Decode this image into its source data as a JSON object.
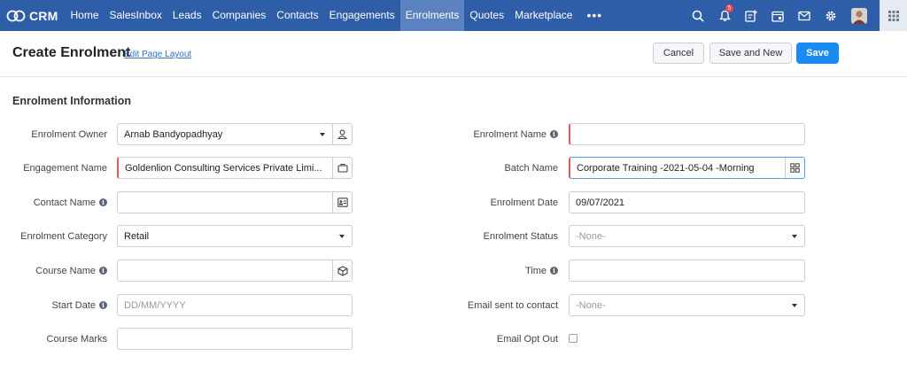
{
  "nav": {
    "brand": "CRM",
    "items": [
      "Home",
      "SalesInbox",
      "Leads",
      "Companies",
      "Contacts",
      "Engagements",
      "Enrolments",
      "Quotes",
      "Marketplace"
    ],
    "active_index": 6,
    "more": "•••",
    "notification_count": "5"
  },
  "page": {
    "title": "Create Enrolment",
    "edit_layout_link": "Edit Page Layout",
    "buttons": {
      "cancel": "Cancel",
      "save_and_new": "Save and New",
      "save": "Save"
    },
    "section_title": "Enrolment Information"
  },
  "form": {
    "left": {
      "enrolment_owner": {
        "label": "Enrolment Owner",
        "value": "Arnab Bandyopadhyay"
      },
      "engagement_name": {
        "label": "Engagement Name",
        "value": "Goldenlion Consulting Services Private Limi..."
      },
      "contact_name": {
        "label": "Contact Name",
        "value": ""
      },
      "enrolment_category": {
        "label": "Enrolment Category",
        "value": "Retail"
      },
      "course_name": {
        "label": "Course Name",
        "value": ""
      },
      "start_date": {
        "label": "Start Date",
        "value": "",
        "placeholder": "DD/MM/YYYY"
      },
      "course_marks": {
        "label": "Course Marks",
        "value": ""
      }
    },
    "right": {
      "enrolment_name": {
        "label": "Enrolment Name",
        "value": ""
      },
      "batch_name": {
        "label": "Batch Name",
        "value": "Corporate Training -2021-05-04 -Morning"
      },
      "enrolment_date": {
        "label": "Enrolment Date",
        "value": "09/07/2021"
      },
      "enrolment_status": {
        "label": "Enrolment Status",
        "value": "-None-"
      },
      "time": {
        "label": "Time",
        "value": ""
      },
      "email_sent_to_contact": {
        "label": "Email sent to contact",
        "value": "-None-"
      },
      "email_opt_out": {
        "label": "Email Opt Out",
        "checked": false
      }
    }
  },
  "colors": {
    "nav_bg": "#2f5ea8",
    "nav_active": "#5a82c0",
    "primary_button": "#1a8bf0",
    "mandatory_marker": "#e25a5a"
  }
}
